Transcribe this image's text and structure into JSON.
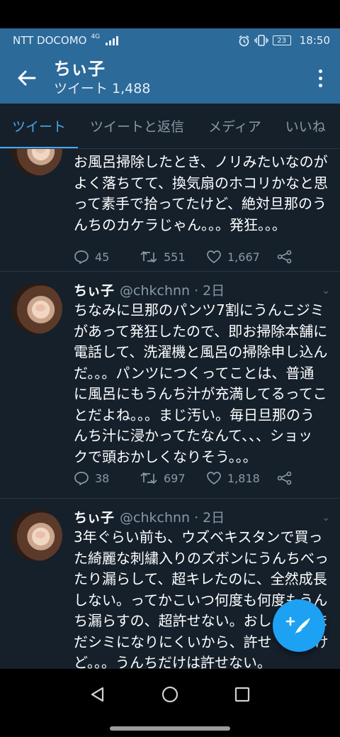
{
  "status_bar": {
    "carrier": "NTT DOCOMO",
    "network": "4G",
    "battery": "23",
    "time": "18:50"
  },
  "header": {
    "title": "ちぃ子",
    "subtitle": "ツイート 1,488",
    "back_icon": "arrow-left-icon",
    "more_icon": "more-vertical-icon",
    "color": "#2c6a9a"
  },
  "tabs": [
    {
      "label": "ツイート",
      "active": true
    },
    {
      "label": "ツイートと返信",
      "active": false
    },
    {
      "label": "メディア",
      "active": false
    },
    {
      "label": "いいね",
      "active": false
    }
  ],
  "tweets": [
    {
      "name": "",
      "handle": "",
      "time": "",
      "lines": [
        "お風呂掃除したとき、ノリみたいなのが",
        "よく落ちてて、換気扇のホコリかなと思",
        "って素手で拾ってたけど、絶対旦那のう",
        "んちのカケラじゃん。。。発狂。。。"
      ],
      "replies": "45",
      "retweets": "551",
      "likes": "1,667"
    },
    {
      "name": "ちぃ子",
      "handle": "@chkchnn",
      "time": "· 2日",
      "lines": [
        "ちなみに旦那のパンツ7割にうんこジミ",
        "があって発狂したので、即お掃除本舗に",
        "電話して、洗濯機と風呂の掃除申し込ん",
        "だ。。。パンツにつくってことは、普通",
        "に風呂にもうんち汁が充満してるってこ",
        "とだよね。。。まじ汚い。毎日旦那のう",
        "んち汁に浸かってたなんて、、、ショッ",
        "クで頭おかしくなりそう。。。"
      ],
      "replies": "38",
      "retweets": "697",
      "likes": "1,818"
    },
    {
      "name": "ちぃ子",
      "handle": "@chkchnn",
      "time": "· 2日",
      "lines": [
        "3年ぐらい前も、ウズベキスタンで買っ",
        "た綺麗な刺繍入りのズボンにうんちべっ",
        "たり漏らして、超キレたのに、全然成長",
        "しない。ってかこいつ何度も何度もうん",
        "ち漏らすの、超許せない。おしっ　　ま",
        "だシミになりにくいから、許せ　　　け",
        "ど。。。うんちだけは許せない。"
      ]
    }
  ],
  "fab": {
    "icon": "compose-tweet-icon",
    "color": "#1da1f2"
  },
  "nav": {
    "icons": [
      "back-triangle-icon",
      "home-circle-icon",
      "recents-square-icon"
    ]
  },
  "accent": "#4aa8ec"
}
